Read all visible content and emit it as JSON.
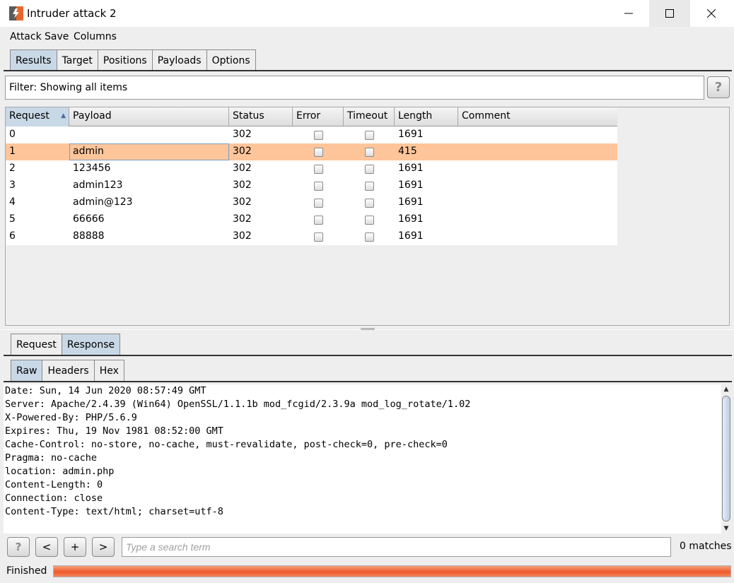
{
  "window": {
    "title": "Intruder attack 2",
    "minimize_glyph": "—",
    "maximize_glyph": "☐",
    "close_glyph": "✕"
  },
  "menu": [
    "Attack",
    "Save",
    "Columns"
  ],
  "main_tabs": [
    "Results",
    "Target",
    "Positions",
    "Payloads",
    "Options"
  ],
  "main_tabs_active": "Results",
  "filter": {
    "text": "Filter: Showing all items",
    "help": "?"
  },
  "results_table": {
    "columns": [
      "Request",
      "Payload",
      "Status",
      "Error",
      "Timeout",
      "Length",
      "Comment"
    ],
    "sorted_column": "Request",
    "sort_glyph": "▲",
    "selected_row": 1,
    "rows": [
      {
        "request": "0",
        "payload": "",
        "status": "302",
        "error": false,
        "timeout": false,
        "length": "1691",
        "comment": ""
      },
      {
        "request": "1",
        "payload": "admin",
        "status": "302",
        "error": false,
        "timeout": false,
        "length": "415",
        "comment": ""
      },
      {
        "request": "2",
        "payload": "123456",
        "status": "302",
        "error": false,
        "timeout": false,
        "length": "1691",
        "comment": ""
      },
      {
        "request": "3",
        "payload": "admin123",
        "status": "302",
        "error": false,
        "timeout": false,
        "length": "1691",
        "comment": ""
      },
      {
        "request": "4",
        "payload": "admin@123",
        "status": "302",
        "error": false,
        "timeout": false,
        "length": "1691",
        "comment": ""
      },
      {
        "request": "5",
        "payload": "66666",
        "status": "302",
        "error": false,
        "timeout": false,
        "length": "1691",
        "comment": ""
      },
      {
        "request": "6",
        "payload": "88888",
        "status": "302",
        "error": false,
        "timeout": false,
        "length": "1691",
        "comment": ""
      }
    ]
  },
  "detail_tabs": [
    "Request",
    "Response"
  ],
  "detail_tabs_active": "Response",
  "view_tabs": [
    "Raw",
    "Headers",
    "Hex"
  ],
  "view_tabs_active": "Raw",
  "response_lines": [
    "Date: Sun, 14 Jun 2020 08:57:49 GMT",
    "Server: Apache/2.4.39 (Win64) OpenSSL/1.1.1b mod_fcgid/2.3.9a mod_log_rotate/1.02",
    "X-Powered-By: PHP/5.6.9",
    "Expires: Thu, 19 Nov 1981 08:52:00 GMT",
    "Cache-Control: no-store, no-cache, must-revalidate, post-check=0, pre-check=0",
    "Pragma: no-cache",
    "location: admin.php",
    "Content-Length: 0",
    "Connection: close",
    "Content-Type: text/html; charset=utf-8"
  ],
  "search": {
    "help": "?",
    "prev": "<",
    "add": "+",
    "next": ">",
    "placeholder": "Type a search term",
    "matches": "0 matches"
  },
  "status": {
    "label": "Finished",
    "progress": 1.0
  },
  "colors": {
    "accent_tab": "#c8d8e6",
    "selected_row": "#ffc59a",
    "progress": "#ee5a2b"
  }
}
